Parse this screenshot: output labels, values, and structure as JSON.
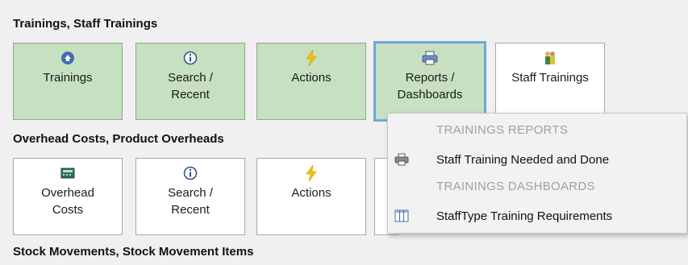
{
  "sections": [
    {
      "title": "Trainings,  Staff Trainings"
    },
    {
      "title": "Overhead Costs,  Product Overheads"
    },
    {
      "title": "Stock Movements,  Stock Movement Items"
    }
  ],
  "row1": {
    "tiles": [
      {
        "label": "Trainings",
        "icon": "trainings-icon"
      },
      {
        "label": "Search /\nRecent",
        "icon": "info-icon"
      },
      {
        "label": "Actions",
        "icon": "lightning-icon"
      },
      {
        "label": "Reports /\nDashboards",
        "icon": "printer-icon"
      },
      {
        "label": "Staff Trainings",
        "icon": "people-icon"
      }
    ]
  },
  "row2": {
    "tiles": [
      {
        "label": "Overhead\nCosts",
        "icon": "calculator-icon"
      },
      {
        "label": "Search /\nRecent",
        "icon": "info-icon"
      },
      {
        "label": "Actions",
        "icon": "lightning-icon"
      }
    ]
  },
  "menu": {
    "reports_header": "TRAININGS  REPORTS",
    "report_item": "Staff Training Needed and Done",
    "dashboards_header": "TRAININGS  DASHBOARDS",
    "dashboard_item": "StaffType Training Requirements"
  },
  "colors": {
    "tile_green": "#c7e0c2",
    "tile_white": "#ffffff",
    "selected_border": "#6ea8d8",
    "menu_header": "#a0a0a0"
  }
}
